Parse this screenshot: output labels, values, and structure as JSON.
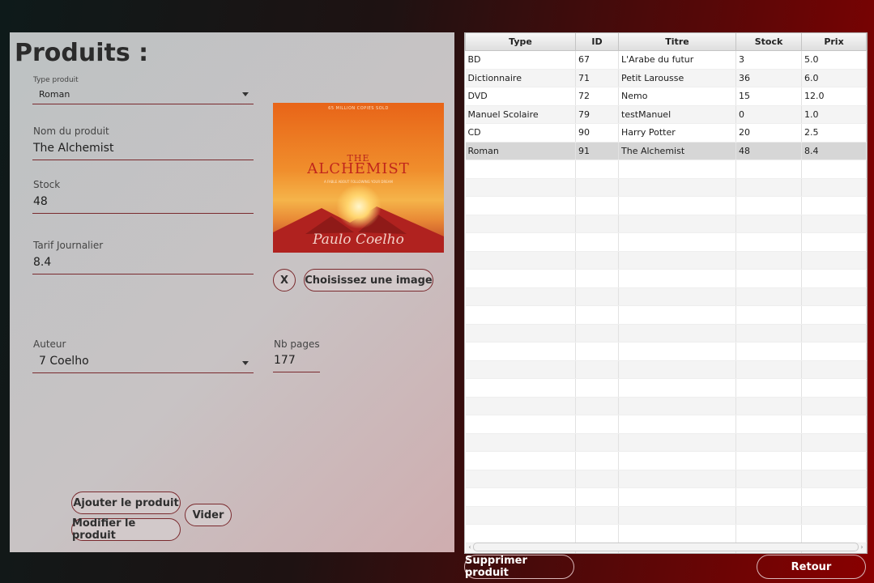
{
  "form": {
    "title": "Produits :",
    "type_label": "Type produit",
    "type_value": "Roman",
    "name_label": "Nom du produit",
    "name_value": "The Alchemist",
    "stock_label": "Stock",
    "stock_value": "48",
    "tarif_label": "Tarif Journalier",
    "tarif_value": "8.4",
    "auteur_label": "Auteur",
    "auteur_value": "7 Coelho",
    "pages_label": "Nb pages",
    "pages_value": "177",
    "clear_image_label": "X",
    "choose_image_label": "Choisissez une image",
    "add_label": "Ajouter le produit",
    "modify_label": "Modifier le produit",
    "empty_label": "Vider"
  },
  "cover": {
    "top_text": "65 MILLION COPIES SOLD",
    "the": "THE",
    "title": "ALCHEMIST",
    "subtitle": "A FABLE ABOUT FOLLOWING YOUR DREAM",
    "author": "Paulo Coelho"
  },
  "table": {
    "columns": [
      "Type",
      "ID",
      "Titre",
      "Stock",
      "Prix"
    ],
    "rows": [
      [
        "BD",
        "67",
        "L'Arabe du futur",
        "3",
        "5.0"
      ],
      [
        "Dictionnaire",
        "71",
        "Petit Larousse",
        "36",
        "6.0"
      ],
      [
        "DVD",
        "72",
        "Nemo",
        "15",
        "12.0"
      ],
      [
        "Manuel Scolaire",
        "79",
        "testManuel",
        "0",
        "1.0"
      ],
      [
        "CD",
        "90",
        "Harry Potter",
        "20",
        "2.5"
      ],
      [
        "Roman",
        "91",
        "The Alchemist",
        "48",
        "8.4"
      ]
    ],
    "selected_row": 5
  },
  "bottom": {
    "delete_label": "Supprimer produit",
    "back_label": "Retour"
  },
  "colors": {
    "accent": "#7a2a2e",
    "selected_row": "#d6d6d6"
  }
}
